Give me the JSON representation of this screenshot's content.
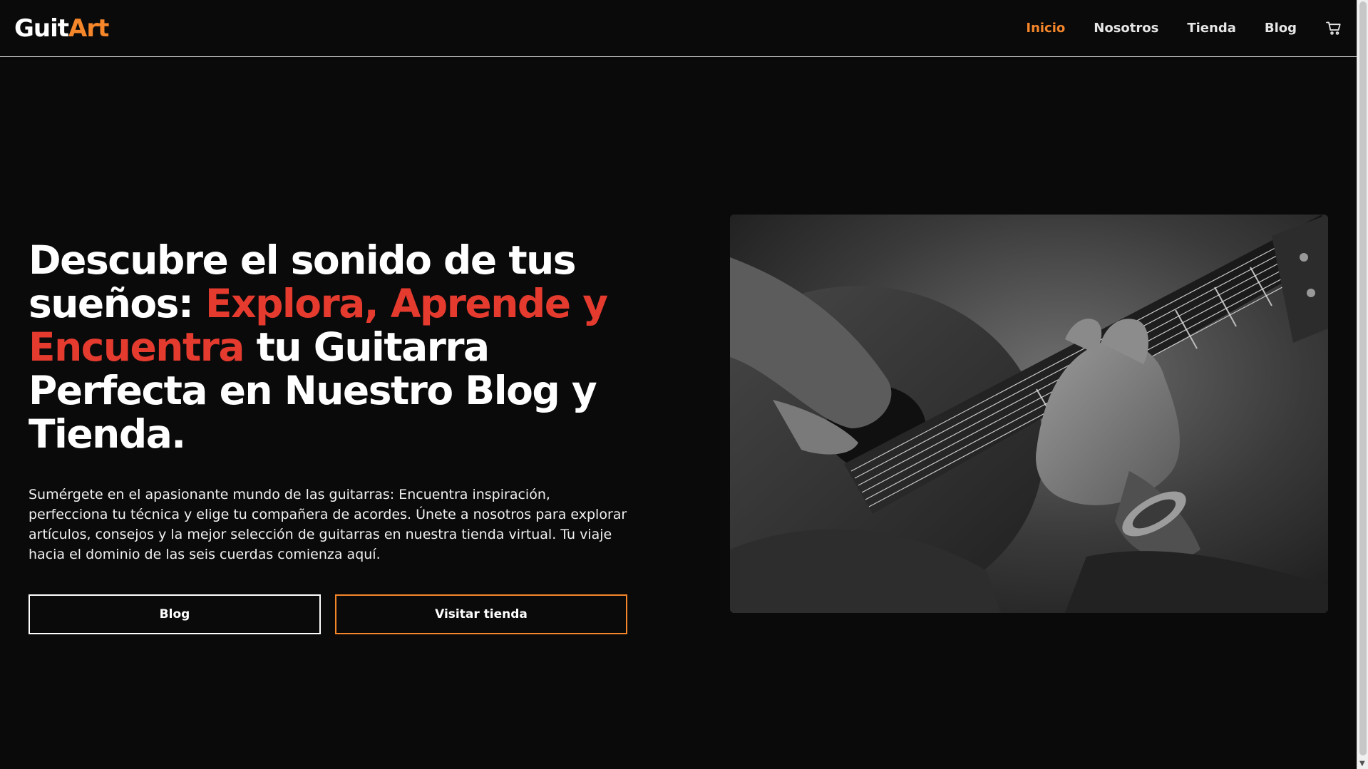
{
  "brand": {
    "name_part1": "Guit",
    "name_part2": "Art",
    "accent_color": "#f5862a"
  },
  "nav": {
    "items": [
      {
        "label": "Inicio",
        "active": true
      },
      {
        "label": "Nosotros",
        "active": false
      },
      {
        "label": "Tienda",
        "active": false
      },
      {
        "label": "Blog",
        "active": false
      }
    ],
    "cart_icon": "cart-icon"
  },
  "hero": {
    "headline_part1": "Descubre el sonido de tus sueños: ",
    "headline_accent": "Explora, Aprende y Encuentra",
    "headline_part2": " tu Guitarra Perfecta en Nuestro Blog y Tienda.",
    "accent_color": "#e53b2f",
    "description": "Sumérgete en el apasionante mundo de las guitarras: Encuentra inspiración, perfecciona tu técnica y elige tu compañera de acordes. Únete a nosotros para explorar artículos, consejos y la mejor selección de guitarras en nuestra tienda virtual. Tu viaje hacia el dominio de las seis cuerdas comienza aquí.",
    "buttons": {
      "blog_label": "Blog",
      "store_label": "Visitar tienda"
    },
    "image": "guitar-player-photo"
  }
}
